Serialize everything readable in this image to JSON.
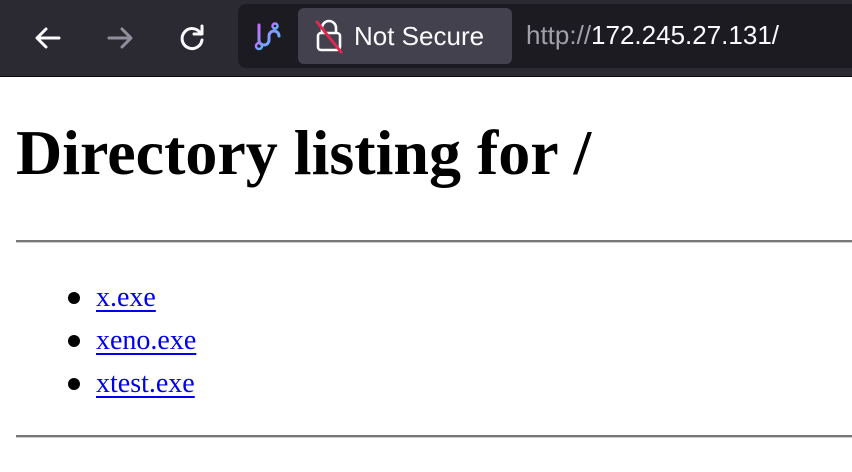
{
  "browser": {
    "security_label": "Not Secure",
    "url_scheme": "http://",
    "url_host": "172.245.27.131/",
    "icons": {
      "back": "back-arrow-icon",
      "forward": "forward-arrow-icon",
      "reload": "reload-icon",
      "extension": "extension-icon",
      "lock": "insecure-lock-icon"
    }
  },
  "page": {
    "heading": "Directory listing for /",
    "files": [
      {
        "name": "x.exe"
      },
      {
        "name": "xeno.exe"
      },
      {
        "name": "xtest.exe"
      }
    ]
  },
  "colors": {
    "toolbar_bg": "#2b2a33",
    "urlbar_bg": "#1c1b22",
    "link": "#0000ee"
  }
}
